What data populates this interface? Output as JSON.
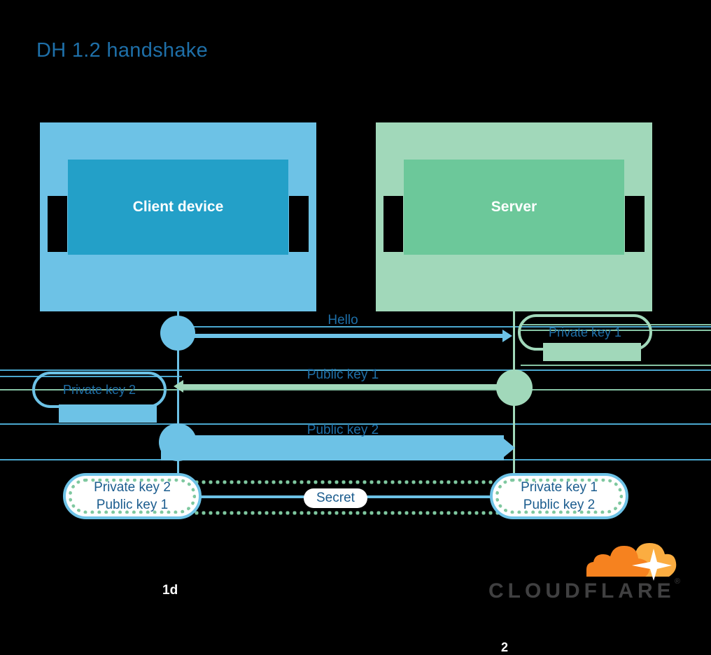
{
  "slide": {
    "title": "DH 1.2 handshake",
    "slide_id": "1d",
    "page_number": "2"
  },
  "colors": {
    "title_blue": "#1E6FA8",
    "client_outer": "#6DC2E6",
    "client_inner": "#23A0C8",
    "server_outer": "#A1D8BA",
    "server_inner": "#6CC89A",
    "label_blue": "#1E6FA8",
    "result_text": "#1B5C8E",
    "dot_green": "#7FC8A0",
    "cloudflare_orange": "#F6821F",
    "cloudflare_orange_light": "#FBAD41",
    "cloudflare_gray": "#404041",
    "background": "#000000"
  },
  "actors": {
    "client": {
      "label": "Client device"
    },
    "server": {
      "label": "Server"
    }
  },
  "messages": [
    {
      "id": "hello",
      "label": "Hello",
      "direction": "client-to-server",
      "color": "#6DC2E6"
    },
    {
      "id": "public-key-1",
      "label": "Public key 1",
      "direction": "server-to-client",
      "color": "#A1D8BA"
    },
    {
      "id": "public-key-2",
      "label": "Public key 2",
      "direction": "client-to-server",
      "color": "#6DC2E6"
    }
  ],
  "key_badges": [
    {
      "id": "private-key-1",
      "label": "Private key 1",
      "side": "server",
      "color": "#A1D8BA"
    },
    {
      "id": "private-key-2",
      "label": "Private key 2",
      "side": "client",
      "color": "#6DC2E6"
    }
  ],
  "results": {
    "client": {
      "line1": "Private key 2",
      "line2": "Public key 1"
    },
    "server": {
      "line1": "Private key 1",
      "line2": "Public key 2"
    }
  },
  "secret": {
    "label": "Secret"
  },
  "branding": {
    "wordmark": "CLOUDFLARE",
    "registered_mark": "®",
    "logo_icon": "cloud-icon"
  }
}
